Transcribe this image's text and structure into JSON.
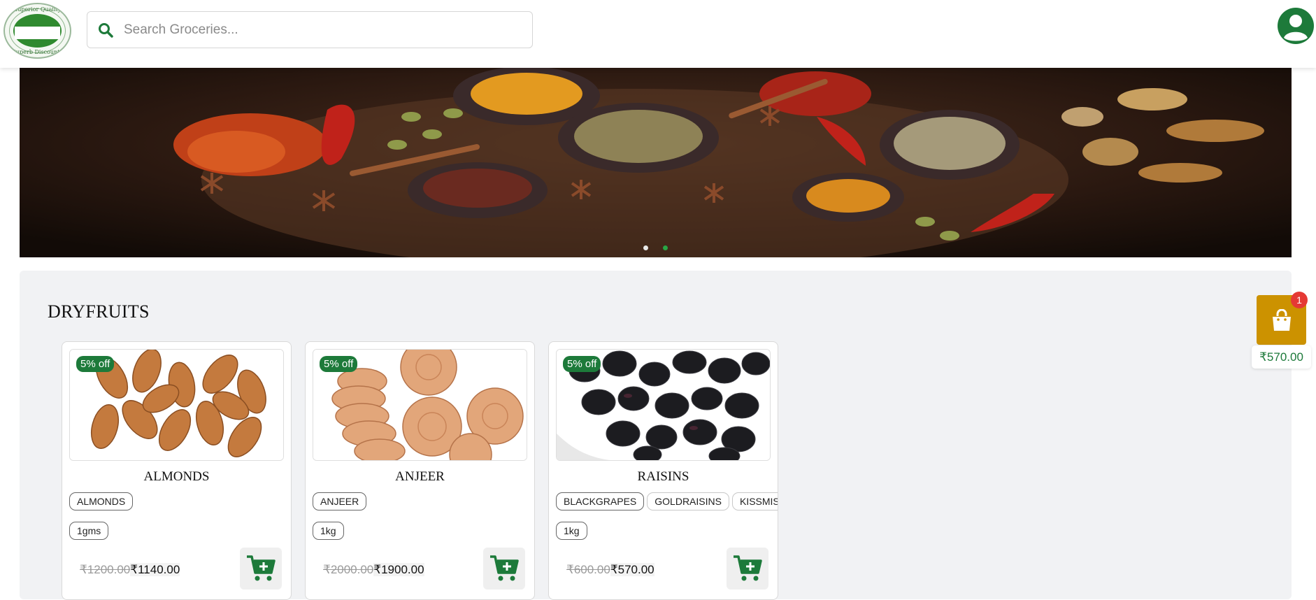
{
  "header": {
    "logo": {
      "top_text": "Superior Quality",
      "bottom_text": "Superb Discounts"
    },
    "search": {
      "placeholder": "Search Groceries..."
    },
    "avatar_icon": "user-circle-icon"
  },
  "banner": {
    "slide_count": 2,
    "active_slide": 2
  },
  "section": {
    "title": "DRYFRUITS",
    "products": [
      {
        "name": "ALMONDS",
        "discount": "5% off",
        "variants": [
          "ALMONDS"
        ],
        "weight": "1gms",
        "old_price": "₹1200.00",
        "price": "₹1140.00"
      },
      {
        "name": "ANJEER",
        "discount": "5% off",
        "variants": [
          "ANJEER"
        ],
        "weight": "1kg",
        "old_price": "₹2000.00",
        "price": "₹1900.00"
      },
      {
        "name": "RAISINS",
        "discount": "5% off",
        "variants": [
          "BLACKGRAPES",
          "GOLDRAISINS",
          "KISSMIS"
        ],
        "weight": "1kg",
        "old_price": "₹600.00",
        "price": "₹570.00"
      }
    ]
  },
  "floating_cart": {
    "count": "1",
    "total": "₹570.00"
  },
  "colors": {
    "brand_green": "#1d7a3a",
    "cart_gold": "#cc9200",
    "badge_red": "#e53935"
  }
}
